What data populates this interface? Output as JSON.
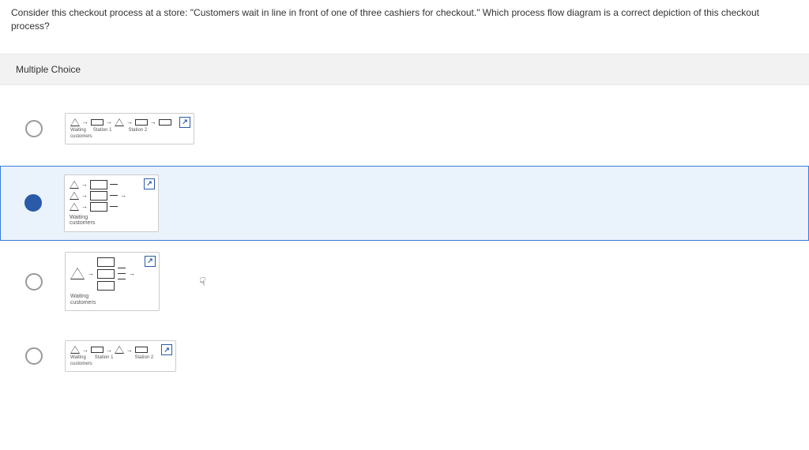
{
  "question": "Consider this checkout process at a store: \"Customers wait in line in front of one of three cashiers for checkout.\" Which process flow diagram is a correct depiction of this checkout process?",
  "section_label": "Multiple Choice",
  "options": [
    {
      "id": "a",
      "selected": false,
      "caption_parts": [
        "Waiting",
        "customers"
      ],
      "row_labels": [
        "Station 1",
        "Station 2"
      ]
    },
    {
      "id": "b",
      "selected": true,
      "caption_parts": [
        "Waiting",
        "customers"
      ]
    },
    {
      "id": "c",
      "selected": false,
      "caption_parts": [
        "Waiting",
        "customers"
      ]
    },
    {
      "id": "d",
      "selected": false,
      "caption_parts": [
        "Waiting",
        "customers"
      ],
      "row_labels": [
        "Station 1",
        "Station 2"
      ]
    }
  ],
  "icons": {
    "expand": "expand-icon"
  }
}
